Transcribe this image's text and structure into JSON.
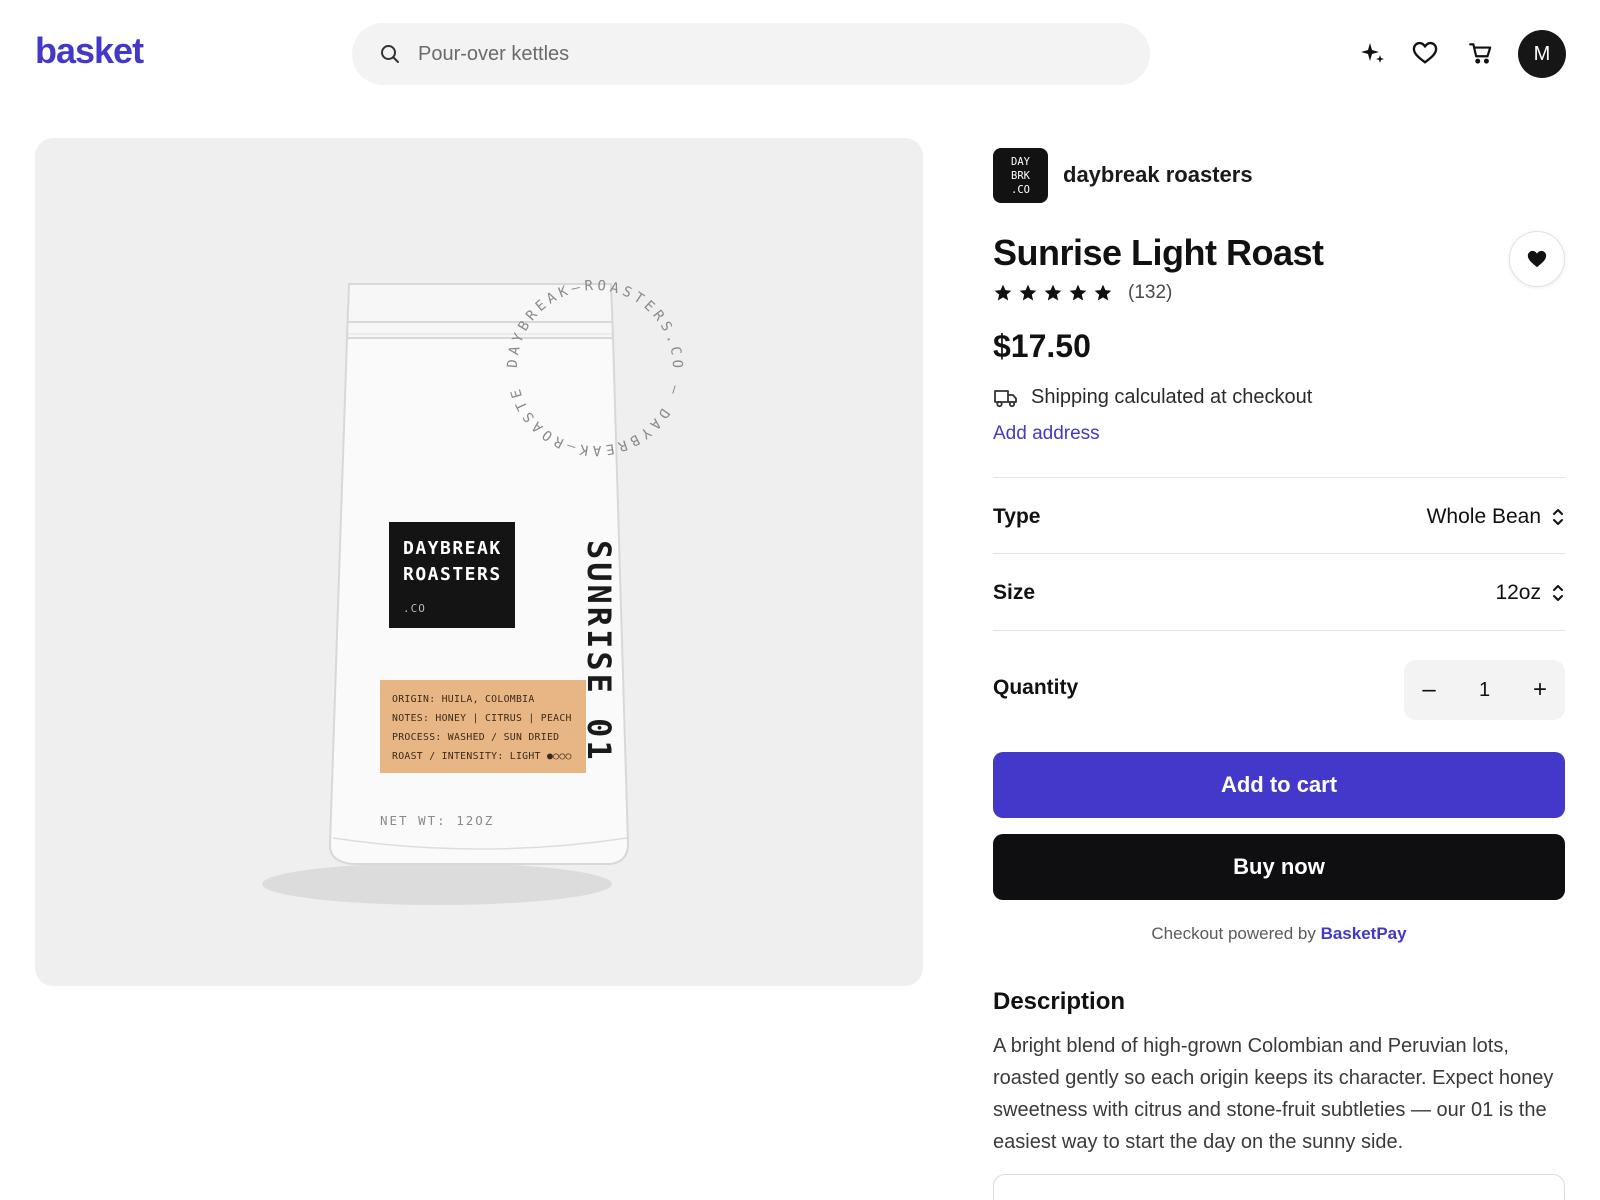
{
  "header": {
    "logo": "basket",
    "search_placeholder": "Pour-over kettles",
    "avatar_initial": "M"
  },
  "shop": {
    "logo_lines": [
      "DAY",
      "BRK",
      ".CO"
    ],
    "name": "daybreak roasters"
  },
  "product": {
    "title": "Sunrise Light Roast",
    "rating": 5,
    "review_count": "(132)",
    "price": "$17.50",
    "shipping_text": "Shipping calculated at checkout",
    "add_address": "Add address"
  },
  "options": {
    "type_label": "Type",
    "type_value": "Whole Bean",
    "size_label": "Size",
    "size_value": "12oz",
    "quantity_label": "Quantity",
    "quantity_value": "1",
    "minus": "–",
    "plus": "+"
  },
  "actions": {
    "add_to_cart": "Add to cart",
    "buy_now": "Buy now",
    "powered_prefix": "Checkout powered by ",
    "powered_brand": "BasketPay"
  },
  "description": {
    "heading": "Description",
    "body": "A bright blend of high-grown Colombian and Peruvian lots, roasted gently so each origin keeps its character. Expect honey sweetness with citrus and stone-fruit subtleties — our 01 is the easiest way to start the day on the sunny side."
  },
  "bag": {
    "brand_line1": "DAYBREAK",
    "brand_line2": "ROASTERS",
    "brand_line3": ".CO",
    "circle_text": "DAYBREAK–ROASTERS.CO – DAYBREAK–ROASTE",
    "vertical_text": "SUNRISE 01",
    "info_lines": [
      "ORIGIN: HUILA, COLOMBIA",
      "NOTES: HONEY | CITRUS | PEACH",
      "PROCESS: WASHED / SUN DRIED",
      "ROAST / INTENSITY: LIGHT ●○○○"
    ],
    "net_wt": "NET WT: 12OZ"
  },
  "colors": {
    "accent": "#4338ca",
    "dark": "#0f0f12",
    "panel": "#efefef",
    "label_tan": "#e8b684"
  }
}
